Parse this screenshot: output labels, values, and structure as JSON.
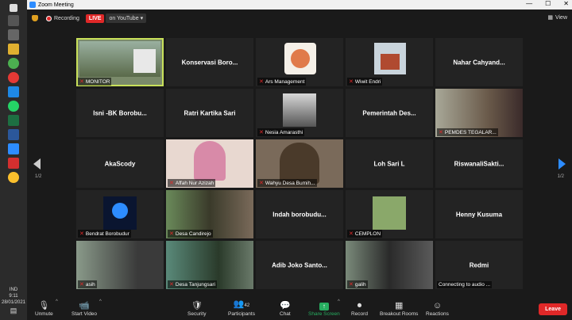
{
  "window": {
    "title": "Zoom Meeting",
    "minimize": "—",
    "maximize": "☐",
    "close": "✕"
  },
  "system": {
    "time": "9:11",
    "date": "28/01/2021",
    "lang": "IND"
  },
  "topbar": {
    "recording": "Recording",
    "live": "LIVE",
    "live_target": "on YouTube",
    "view": "View"
  },
  "page_indicator": {
    "left": "1/2",
    "right": "1/2"
  },
  "tiles": [
    {
      "label": "MONITOR",
      "video": true,
      "active": true
    },
    {
      "name": "Konservasi Boro...",
      "video": false
    },
    {
      "label": "Ars Management",
      "video": true
    },
    {
      "label": "Wiwit Endri",
      "video": true
    },
    {
      "name": "Nahar Cahyand...",
      "video": false
    },
    {
      "name": "Isni -BK Borobu...",
      "video": false
    },
    {
      "name": "Ratri Kartika Sari",
      "video": false
    },
    {
      "label": "Nesia Amarasthi",
      "video": true
    },
    {
      "name": "Pemerintah Des...",
      "video": false
    },
    {
      "label": "PEMDES TEGALAR...",
      "video": true
    },
    {
      "name": "AkaScody",
      "video": false
    },
    {
      "label": "Affah Nur Azizah",
      "video": true
    },
    {
      "label": "Wahyu Desa Bumih...",
      "video": true
    },
    {
      "name": "Loh Sari L",
      "video": false
    },
    {
      "name": "RiswanaliSakti...",
      "video": false
    },
    {
      "label": "Bendrat Borobudur",
      "video": true
    },
    {
      "label": "Desa Candirejo",
      "video": true
    },
    {
      "name": "Indah borobudu...",
      "video": false
    },
    {
      "label": "CEMPLON",
      "video": true
    },
    {
      "name": "Henny Kusuma",
      "video": false
    },
    {
      "label": "asih",
      "video": true
    },
    {
      "label": "Desa Tanjungsari",
      "video": true
    },
    {
      "name": "Adib Joko Santo...",
      "video": false
    },
    {
      "label": "galih",
      "video": true
    },
    {
      "name": "Redmi",
      "label": "Connecting to audio ...",
      "video": false
    }
  ],
  "toolbar": {
    "unmute": "Unmute",
    "start_video": "Start Video",
    "security": "Security",
    "participants": "Participants",
    "participants_count": "42",
    "chat": "Chat",
    "share_screen": "Share Screen",
    "record": "Record",
    "breakout": "Breakout Rooms",
    "reactions": "Reactions",
    "leave": "Leave"
  },
  "colors": {
    "accent": "#2d8cff",
    "live": "#e02828",
    "share": "#27ae60",
    "active_speaker": "#c8e05a"
  }
}
